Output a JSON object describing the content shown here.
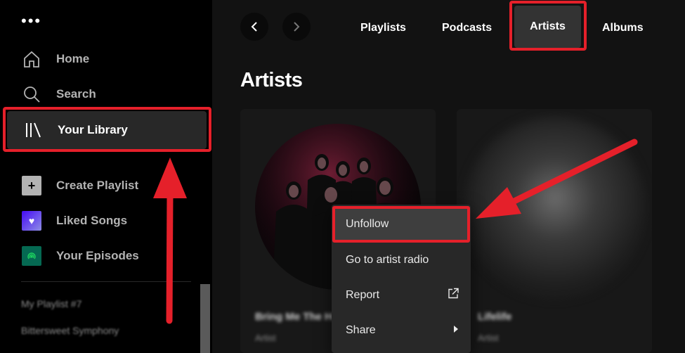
{
  "sidebar": {
    "more_glyph": "•••",
    "nav": [
      {
        "label": "Home",
        "icon": "home-icon"
      },
      {
        "label": "Search",
        "icon": "search-icon"
      },
      {
        "label": "Your Library",
        "icon": "library-icon"
      }
    ],
    "actions": [
      {
        "label": "Create Playlist",
        "icon": "plus-icon"
      },
      {
        "label": "Liked Songs",
        "icon": "heart-icon"
      },
      {
        "label": "Your Episodes",
        "icon": "podcast-icon"
      }
    ],
    "playlists": [
      "My Playlist #7",
      "Bittersweet Symphony"
    ]
  },
  "header": {
    "tabs": [
      "Playlists",
      "Podcasts",
      "Artists",
      "Albums"
    ],
    "active_tab": "Artists"
  },
  "main": {
    "title": "Artists",
    "cards": [
      {
        "name": "Bring Me The Horizon",
        "subtitle": "Artist"
      },
      {
        "name": "Lifelife",
        "subtitle": "Artist"
      }
    ]
  },
  "context_menu": {
    "items": [
      "Unfollow",
      "Go to artist radio",
      "Report",
      "Share"
    ]
  },
  "colors": {
    "annotation_red": "#e5202a",
    "background": "#121212",
    "sidebar": "#000000"
  }
}
